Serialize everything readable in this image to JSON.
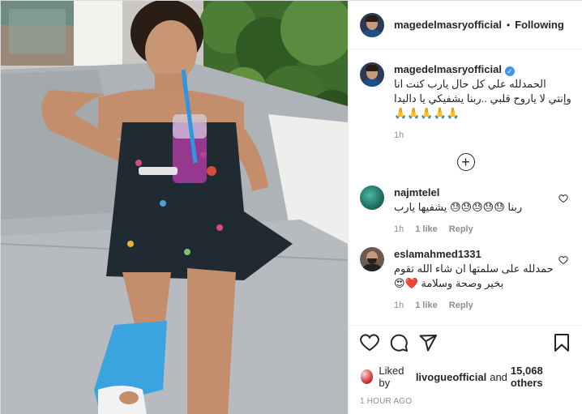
{
  "header": {
    "username": "magedelmasryofficial",
    "separator": "•",
    "follow_state": "Following"
  },
  "caption": {
    "username": "magedelmasryofficial",
    "verified_mark": "✓",
    "text": "الحمدلله علي كل حال يارب كنت انا وإنتي لا ياروح قلبي ..ربنا يشفيكي يا داليدا 🙏🙏🙏🙏🙏",
    "time": "1h"
  },
  "load_more_label": "+",
  "comments": [
    {
      "username": "najmtelel",
      "text": "ربنا 😓😓😓😓😓 يشفيها يارب",
      "time": "1h",
      "likes": "1 like",
      "reply": "Reply"
    },
    {
      "username": "eslamahmed1331",
      "text": "حمدلله على سلمتها ان شاء الله تقوم بخير وصحة وسلامة ❤️😍",
      "time": "1h",
      "likes": "1 like",
      "reply": "Reply"
    }
  ],
  "actions": {
    "icons": [
      "heart-icon",
      "comment-icon",
      "share-icon",
      "bookmark-icon"
    ]
  },
  "likes": {
    "prefix": "Liked by",
    "first_liker": "livogueofficial",
    "joiner": "and",
    "others": "15,068 others"
  },
  "timestamp": "1 HOUR AGO",
  "colors": {
    "text": "#262626",
    "muted": "#8e8e8e",
    "verified": "#3897f0",
    "border": "#efefef"
  }
}
